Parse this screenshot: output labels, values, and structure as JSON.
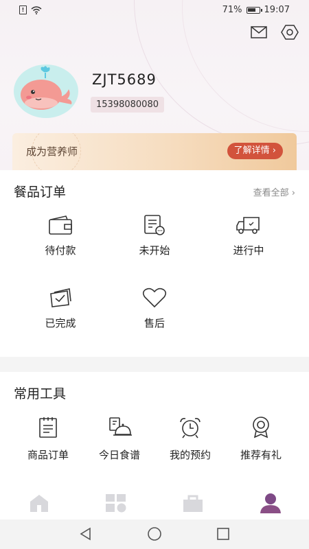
{
  "status_bar": {
    "battery": "71%",
    "battery_level": 0.71,
    "time": "19:07"
  },
  "header": {
    "mail_icon": "mail-icon",
    "settings_icon": "settings-hex-icon",
    "username": "ZJT5689",
    "phone": "15398080080"
  },
  "promo": {
    "text": "成为营养师",
    "button": "了解详情 ›"
  },
  "orders": {
    "title": "餐品订单",
    "view_all": "查看全部 ›",
    "items": [
      {
        "label": "待付款",
        "icon": "wallet-icon"
      },
      {
        "label": "未开始",
        "icon": "document-pending-icon"
      },
      {
        "label": "进行中",
        "icon": "delivery-truck-icon"
      },
      {
        "label": "已完成",
        "icon": "checked-box-icon"
      },
      {
        "label": "售后",
        "icon": "heart-icon"
      }
    ]
  },
  "tools": {
    "title": "常用工具",
    "items": [
      {
        "label": "商品订单",
        "icon": "clipboard-icon"
      },
      {
        "label": "今日食谱",
        "icon": "dish-cover-icon"
      },
      {
        "label": "我的预约",
        "icon": "alarm-clock-icon"
      },
      {
        "label": "推荐有礼",
        "icon": "award-badge-icon"
      }
    ]
  },
  "tabbar": {
    "tabs": [
      {
        "icon": "home-icon",
        "active": false
      },
      {
        "icon": "category-grid-icon",
        "active": false
      },
      {
        "icon": "shopping-bag-icon",
        "active": false
      },
      {
        "icon": "profile-icon",
        "active": true
      }
    ]
  },
  "colors": {
    "accent": "#d2533c",
    "active_tab": "#8a4f86",
    "inactive_tab": "#d8d8dc"
  }
}
